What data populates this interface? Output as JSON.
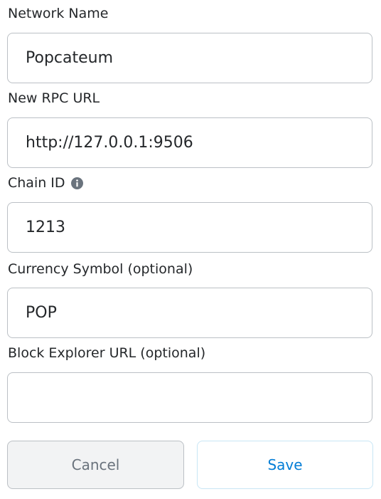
{
  "form": {
    "network_name": {
      "label": "Network Name",
      "value": "Popcateum",
      "placeholder": ""
    },
    "rpc_url": {
      "label": "New RPC URL",
      "value": "http://127.0.0.1:9506",
      "placeholder": ""
    },
    "chain_id": {
      "label": "Chain ID",
      "value": "1213",
      "placeholder": "",
      "info_icon": "info-circle-icon"
    },
    "currency_symbol": {
      "label": "Currency Symbol (optional)",
      "value": "POP",
      "placeholder": ""
    },
    "block_explorer": {
      "label": "Block Explorer URL (optional)",
      "value": "",
      "placeholder": ""
    }
  },
  "actions": {
    "cancel_label": "Cancel",
    "save_label": "Save"
  },
  "colors": {
    "text": "#24272a",
    "border": "#bbc0c5",
    "accent": "#037dd6",
    "cancel_bg": "#f2f3f4",
    "cancel_text": "#6a737d",
    "save_border": "#c8e6f5",
    "info_icon": "#6a737d"
  }
}
